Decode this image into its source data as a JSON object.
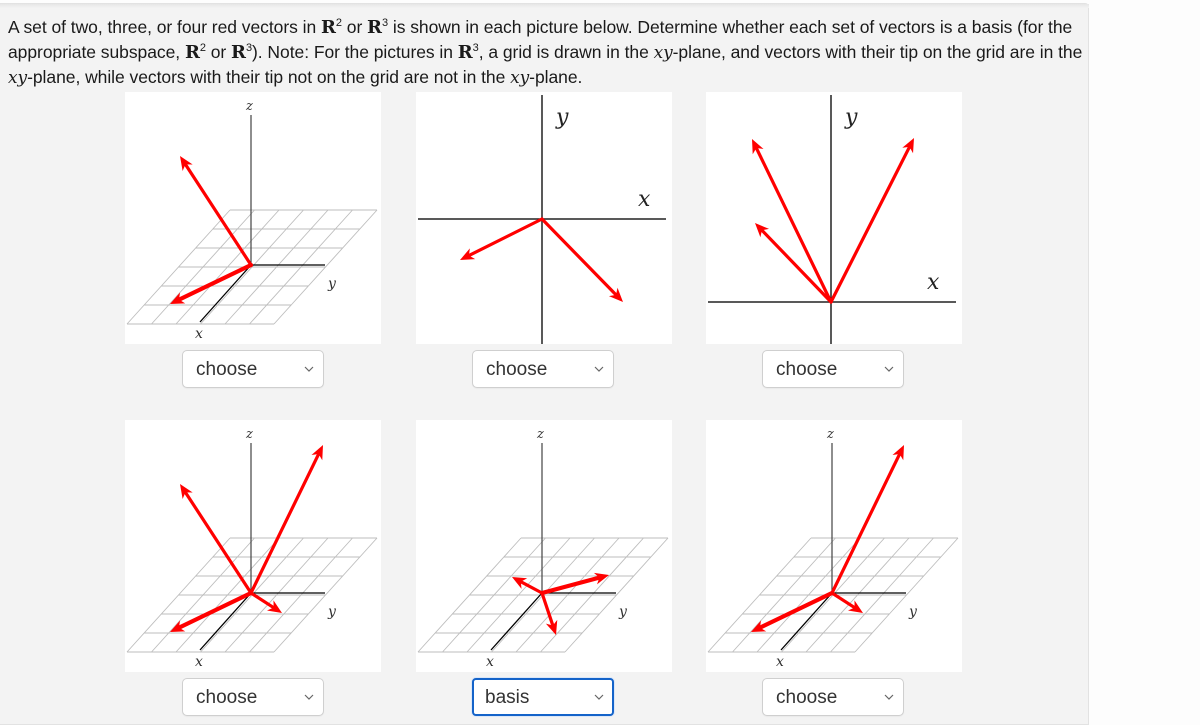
{
  "question": {
    "seg1": "A set of two, three, or four red vectors in ",
    "seg2": " or ",
    "seg3": " is shown in each picture below. Determine whether each set of vectors is a basis (for the appropriate subspace, ",
    "seg4": " or ",
    "seg5": "). Note: For the pictures in ",
    "seg6": ", a grid is drawn in the ",
    "seg7": "-plane, and vectors with their tip on the grid are in the ",
    "seg8": "-plane, while vectors with their tip not on the grid are not in the ",
    "seg9": "-plane.",
    "R": "R",
    "exp2": "2",
    "exp3": "3",
    "xy": "xy"
  },
  "axis_labels": {
    "x": "x",
    "y": "y",
    "z": "z"
  },
  "vector_color": "#ff0000",
  "figures": [
    {
      "id": "fig1",
      "space": "R3",
      "vectors": [
        "up-left (out of xy-plane)",
        "in xy-plane toward +x/-y"
      ]
    },
    {
      "id": "fig2",
      "space": "R2",
      "vectors": [
        "down-left",
        "down-right"
      ]
    },
    {
      "id": "fig3",
      "space": "R2",
      "vectors": [
        "up-left (long)",
        "up-left (short)",
        "up-right"
      ]
    },
    {
      "id": "fig4",
      "space": "R3",
      "vectors": [
        "up-left (out of xy-plane)",
        "up-right (out of xy-plane)",
        "in xy-plane toward +x/-y",
        "in xy-plane toward +x/+y"
      ]
    },
    {
      "id": "fig5",
      "space": "R3",
      "vectors": [
        "in xy-plane toward -x",
        "in xy-plane toward +y",
        "in xy-plane toward +x"
      ]
    },
    {
      "id": "fig6",
      "space": "R3",
      "vectors": [
        "up-right (out of xy-plane)",
        "in xy-plane toward +x/-y",
        "in xy-plane toward +x/+y"
      ]
    }
  ],
  "answers": [
    {
      "selected": "choose",
      "focused": false
    },
    {
      "selected": "choose",
      "focused": false
    },
    {
      "selected": "choose",
      "focused": false
    },
    {
      "selected": "choose",
      "focused": false
    },
    {
      "selected": "basis",
      "focused": true
    },
    {
      "selected": "choose",
      "focused": false
    }
  ]
}
